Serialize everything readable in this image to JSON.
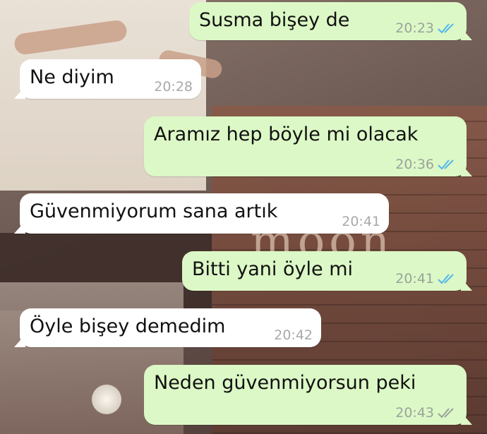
{
  "messages": [
    {
      "direction": "out",
      "text": "Susma bişey de",
      "time": "20:23",
      "status": "read"
    },
    {
      "direction": "in",
      "text": "Ne diyim",
      "time": "20:28"
    },
    {
      "direction": "out",
      "text": "Aramız hep böyle mi olacak",
      "time": "20:36",
      "status": "read"
    },
    {
      "direction": "in",
      "text": "Güvenmiyorum sana artık",
      "time": "20:41"
    },
    {
      "direction": "out",
      "text": "Bitti yani öyle mi",
      "time": "20:41",
      "status": "read"
    },
    {
      "direction": "in",
      "text": "Öyle bişey demedim",
      "time": "20:42"
    },
    {
      "direction": "out",
      "text": "Neden güvenmiyorsun peki",
      "time": "20:43",
      "status": "delivered"
    }
  ],
  "background": {
    "neon_text": "moon"
  },
  "colors": {
    "outgoing_bubble": "#dcf8c6",
    "incoming_bubble": "#ffffff",
    "read_tick": "#4fb6ec",
    "delivered_tick": "#9aa39b",
    "timestamp": "#9aa39b"
  },
  "icons": {
    "read": "double-check-icon",
    "delivered": "double-check-icon"
  }
}
